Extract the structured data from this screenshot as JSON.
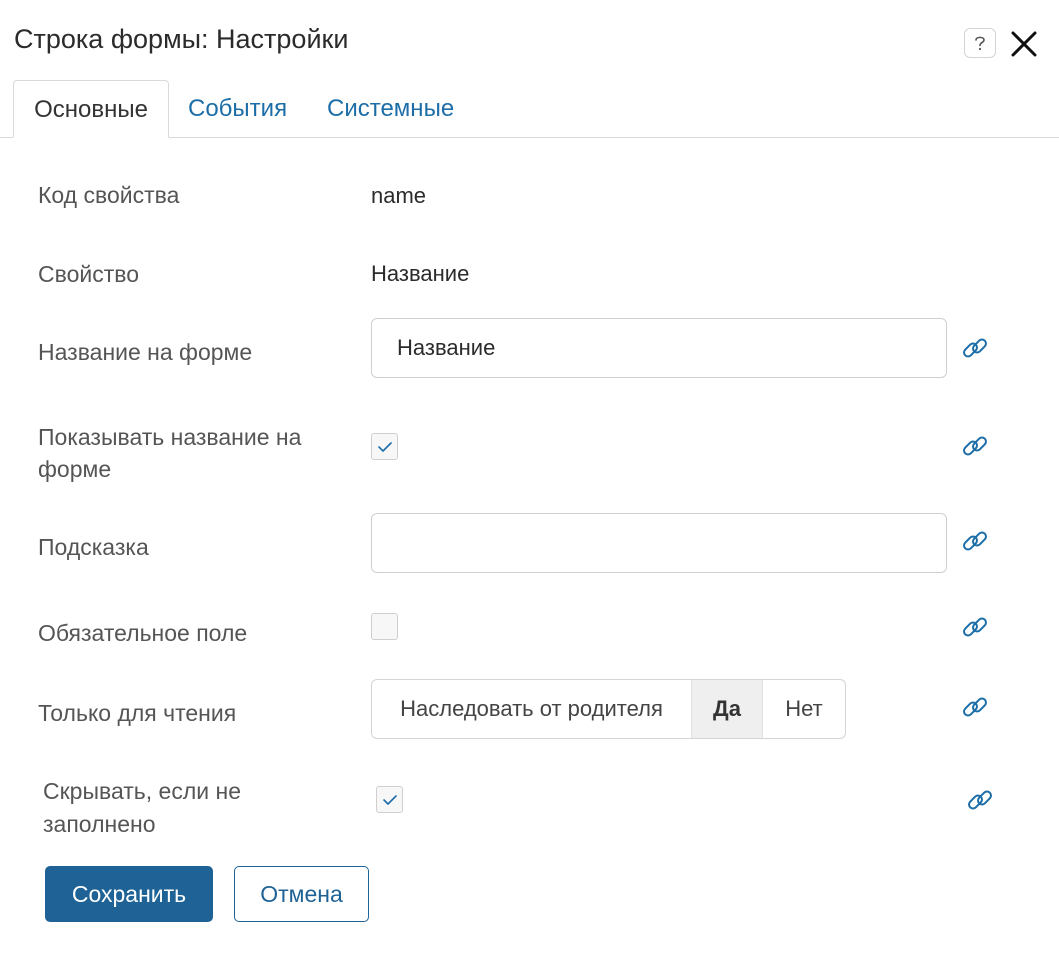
{
  "dialog": {
    "title": "Строка формы: Настройки"
  },
  "tabs": [
    {
      "label": "Основные",
      "active": true
    },
    {
      "label": "События",
      "active": false
    },
    {
      "label": "Системные",
      "active": false
    }
  ],
  "fields": {
    "property_code": {
      "label": "Код свойства",
      "value": "name"
    },
    "property": {
      "label": "Свойство",
      "value": "Название"
    },
    "form_name": {
      "label": "Название на форме",
      "value": "Название"
    },
    "show_name": {
      "label_line1": "Показывать название на",
      "label_line2": "форме",
      "checked": true
    },
    "hint": {
      "label": "Подсказка",
      "value": ""
    },
    "required": {
      "label": "Обязательное поле",
      "checked": false
    },
    "read_only": {
      "label": "Только для чтения",
      "options": [
        "Наследовать от родителя",
        "Да",
        "Нет"
      ],
      "selected": "Да"
    },
    "hide_if_empty": {
      "label_line1": "Скрывать, если не",
      "label_line2": "заполнено",
      "checked": true
    }
  },
  "footer": {
    "save_label": "Сохранить",
    "cancel_label": "Отмена"
  },
  "colors": {
    "accent": "#1f6396",
    "link": "#1d6ea8"
  },
  "icons": {
    "help": "question-icon",
    "close": "close-icon",
    "link": "link-icon",
    "check": "checkmark-icon"
  }
}
